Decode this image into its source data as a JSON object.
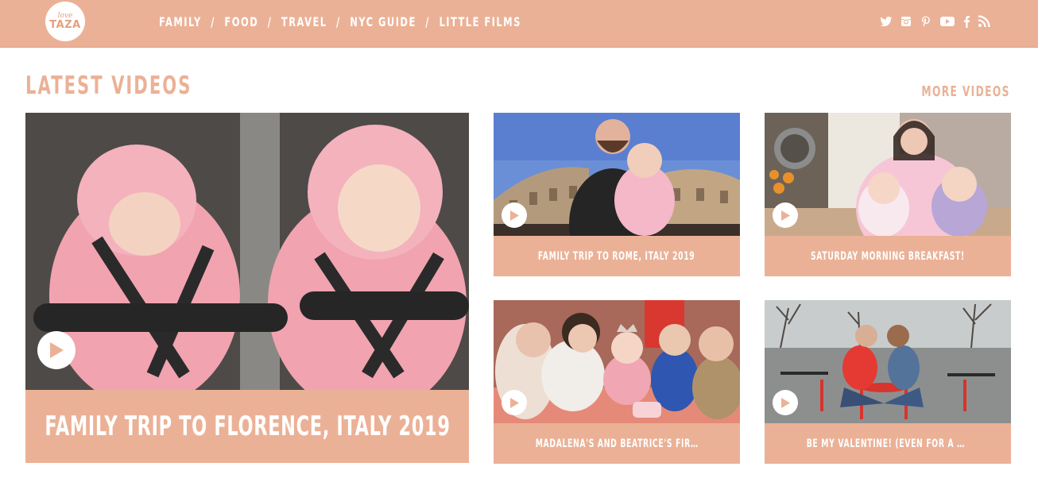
{
  "logo": {
    "line1": "love",
    "line2": "TAZA"
  },
  "nav": {
    "items": [
      {
        "label": "FAMILY"
      },
      {
        "label": "FOOD"
      },
      {
        "label": "TRAVEL"
      },
      {
        "label": "NYC GUIDE"
      },
      {
        "label": "LITTLE FILMS"
      }
    ],
    "separator": "/"
  },
  "social": [
    "twitter-icon",
    "instagram-icon",
    "pinterest-icon",
    "youtube-icon",
    "facebook-icon",
    "rss-icon"
  ],
  "section": {
    "title": "LATEST VIDEOS",
    "more_label": "MORE VIDEOS"
  },
  "videos": {
    "featured": {
      "title": "FAMILY TRIP TO FLORENCE, ITALY 2019"
    },
    "rome": {
      "title": "FAMILY TRIP TO ROME, ITALY 2019"
    },
    "breakfast": {
      "title": "SATURDAY MORNING BREAKFAST!"
    },
    "birthday": {
      "title": "MADALENA'S AND BEATRICE'S FIRST BIRTHDAY …"
    },
    "valentine": {
      "title": "BE MY VALENTINE! (EVEN FOR A MINUTE OR TW…"
    }
  },
  "colors": {
    "accent": "#ebb196",
    "text_on_accent": "#ffffff"
  }
}
